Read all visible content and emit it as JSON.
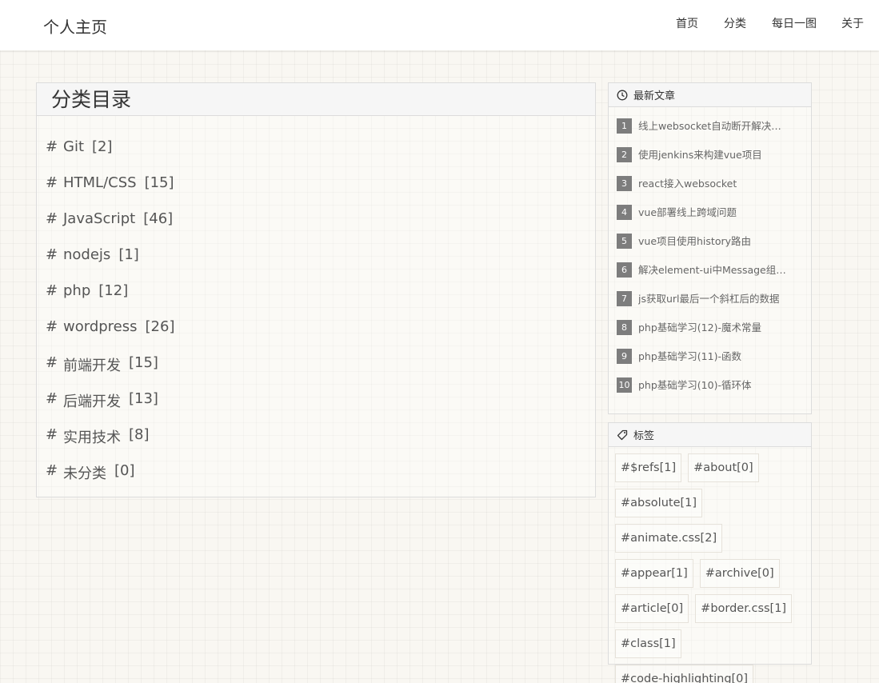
{
  "header": {
    "site_title": "个人主页",
    "nav": [
      "首页",
      "分类",
      "每日一图",
      "关于"
    ]
  },
  "main": {
    "title": "分类目录",
    "hash_symbol": "#",
    "categories": [
      {
        "name": "Git",
        "count": "[2]"
      },
      {
        "name": "HTML/CSS",
        "count": "[15]"
      },
      {
        "name": "JavaScript",
        "count": "[46]"
      },
      {
        "name": "nodejs",
        "count": "[1]"
      },
      {
        "name": "php",
        "count": "[12]"
      },
      {
        "name": "wordpress",
        "count": "[26]"
      },
      {
        "name": "前端开发",
        "count": "[15]"
      },
      {
        "name": "后端开发",
        "count": "[13]"
      },
      {
        "name": "实用技术",
        "count": "[8]"
      },
      {
        "name": "未分类",
        "count": "[0]"
      }
    ]
  },
  "recent": {
    "title": "最新文章",
    "icon": "clock-icon",
    "posts": [
      {
        "num": "1",
        "title": "线上websocket自动断开解决思路"
      },
      {
        "num": "2",
        "title": "使用jenkins来构建vue项目"
      },
      {
        "num": "3",
        "title": "react接入websocket"
      },
      {
        "num": "4",
        "title": "vue部署线上跨域问题"
      },
      {
        "num": "5",
        "title": "vue项目使用history路由"
      },
      {
        "num": "6",
        "title": "解决element-ui中Message组件..."
      },
      {
        "num": "7",
        "title": "js获取url最后一个斜杠后的数据"
      },
      {
        "num": "8",
        "title": "php基础学习(12)-魔术常量"
      },
      {
        "num": "9",
        "title": "php基础学习(11)-函数"
      },
      {
        "num": "10",
        "title": "php基础学习(10)-循环体"
      }
    ]
  },
  "tags": {
    "title": "标签",
    "icon": "tag-icon",
    "items": [
      "#$refs[1]",
      "#about[0]",
      "#absolute[1]",
      "#animate.css[2]",
      "#appear[1]",
      "#archive[0]",
      "#article[0]",
      "#border.css[1]",
      "#class[1]",
      "#code-highlighting[0]"
    ]
  }
}
